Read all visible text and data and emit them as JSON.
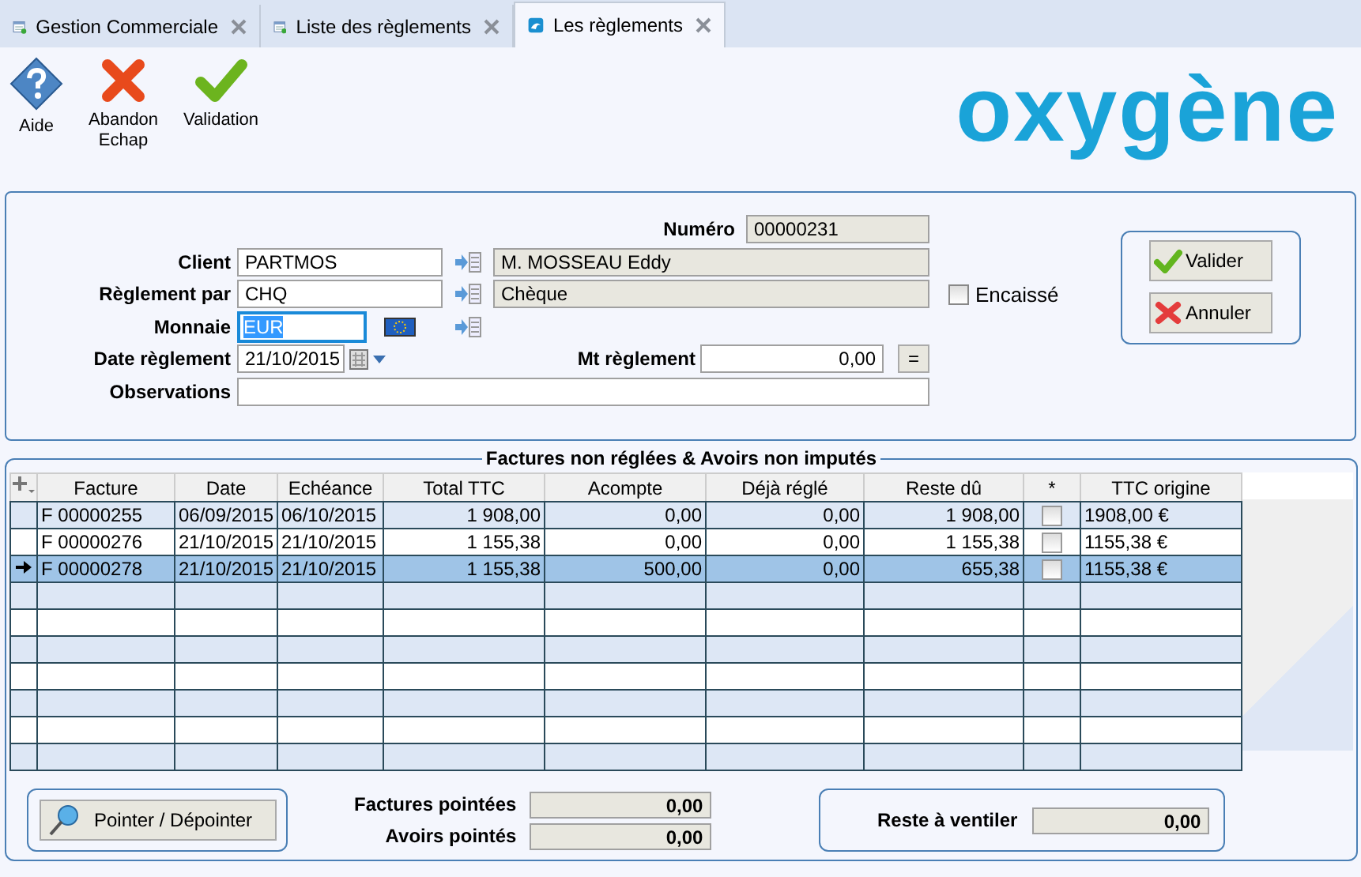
{
  "tabs": [
    {
      "label": "Gestion Commerciale",
      "kind": "list",
      "selected": false
    },
    {
      "label": "Liste des règlements",
      "kind": "list",
      "selected": false
    },
    {
      "label": "Les règlements",
      "kind": "app",
      "selected": true
    }
  ],
  "toolbar": [
    {
      "label": "Aide",
      "kind": "help"
    },
    {
      "label": "Abandon\nEchap",
      "kind": "cancel"
    },
    {
      "label": "Validation",
      "kind": "validate"
    }
  ],
  "logo": {
    "text": "oxygène"
  },
  "form": {
    "numero": {
      "label": "Numéro",
      "value": "00000231"
    },
    "client": {
      "label": "Client",
      "value": "PARTMOS",
      "name": "M. MOSSEAU Eddy"
    },
    "reglement_par": {
      "label": "Règlement par",
      "value": "CHQ",
      "name": "Chèque"
    },
    "monnaie": {
      "label": "Monnaie",
      "value": "EUR",
      "selected": true
    },
    "date_reglement": {
      "label": "Date règlement",
      "value": "21/10/2015"
    },
    "mt_reglement": {
      "label": "Mt règlement",
      "value": "0,00",
      "button": "="
    },
    "observations": {
      "label": "Observations"
    },
    "encaisse": {
      "label": "Encaissé",
      "checked": false
    },
    "buttons": [
      {
        "label": "Valider",
        "kind": "ok"
      },
      {
        "label": "Annuler",
        "kind": "cancel"
      }
    ]
  },
  "table": {
    "title": "Factures non réglées & Avoirs non imputés",
    "columns": [
      {
        "label": "Facture",
        "kind": "text"
      },
      {
        "label": "Date",
        "kind": "text"
      },
      {
        "label": "Echéance",
        "kind": "text"
      },
      {
        "label": "Total TTC",
        "kind": "number"
      },
      {
        "label": "Acompte",
        "kind": "number"
      },
      {
        "label": "Déjà réglé",
        "kind": "number"
      },
      {
        "label": "Reste dû",
        "kind": "number"
      },
      {
        "label": "*",
        "kind": "check"
      },
      {
        "label": "TTC origine",
        "kind": "text"
      }
    ],
    "rows": [
      {
        "cells": [
          "F 00000255",
          "06/09/2015",
          "06/10/2015",
          "1 908,00",
          "0,00",
          "0,00",
          "1 908,00",
          "",
          "1908,00 €"
        ],
        "checked": false,
        "selected": false
      },
      {
        "cells": [
          "F 00000276",
          "21/10/2015",
          "21/10/2015",
          "1 155,38",
          "0,00",
          "0,00",
          "1 155,38",
          "",
          "1155,38 €"
        ],
        "checked": false,
        "selected": false
      },
      {
        "cells": [
          "F 00000278",
          "21/10/2015",
          "21/10/2015",
          "1 155,38",
          "500,00",
          "0,00",
          "655,38",
          "",
          "1155,38 €"
        ],
        "checked": false,
        "selected": true
      }
    ]
  },
  "footer": {
    "pointer_button": "Pointer / Dépointer",
    "factures_pointees": {
      "label": "Factures pointées",
      "value": "0,00"
    },
    "avoirs_pointes": {
      "label": "Avoirs pointés",
      "value": "0,00"
    },
    "reste_a_ventiler": {
      "label": "Reste à ventiler",
      "value": "0,00"
    }
  }
}
